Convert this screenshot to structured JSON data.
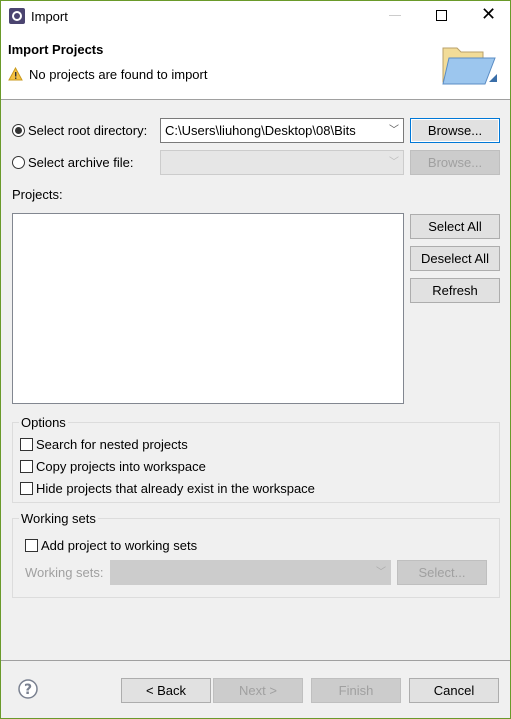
{
  "window": {
    "title": "Import",
    "icon": "eclipse-icon",
    "border_color": "#6a9a2a"
  },
  "header": {
    "title": "Import Projects",
    "message": "No projects are found to import",
    "message_icon": "warning-icon",
    "banner_icon": "folder-open-icon"
  },
  "source": {
    "root_label": "Select root directory:",
    "root_selected": true,
    "root_value": "C:\\Users\\liuhong\\Desktop\\08\\Bits",
    "root_browse": "Browse...",
    "archive_label": "Select archive file:",
    "archive_selected": false,
    "archive_value": "",
    "archive_browse": "Browse..."
  },
  "projects": {
    "label": "Projects:",
    "items": [],
    "select_all": "Select All",
    "deselect_all": "Deselect All",
    "refresh": "Refresh"
  },
  "options": {
    "title": "Options",
    "items": [
      {
        "label": "Search for nested projects",
        "checked": false
      },
      {
        "label": "Copy projects into workspace",
        "checked": false
      },
      {
        "label": "Hide projects that already exist in the workspace",
        "checked": false
      }
    ]
  },
  "working_sets": {
    "title": "Working sets",
    "add_label": "Add project to working sets",
    "add_checked": false,
    "sets_label": "Working sets:",
    "sets_value": "",
    "select_button": "Select..."
  },
  "footer": {
    "help_icon": "help-icon",
    "back": "< Back",
    "next": "Next >",
    "finish": "Finish",
    "cancel": "Cancel"
  }
}
